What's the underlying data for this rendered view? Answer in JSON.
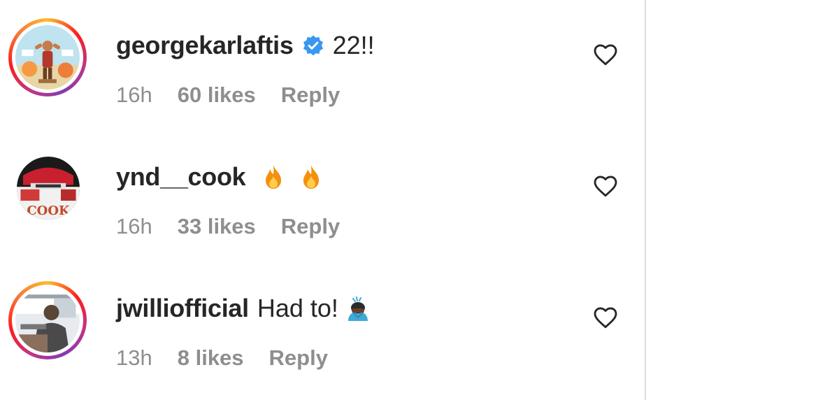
{
  "comments": [
    {
      "username": "georgekarlaftis",
      "verified": true,
      "text": "22!!",
      "time": "16h",
      "likes": "60 likes",
      "reply": "Reply",
      "avatar_ring": "story",
      "icons": {
        "verified": "verified-badge-icon",
        "like": "heart-outline-icon"
      }
    },
    {
      "username": "ynd__cook",
      "verified": false,
      "text": "",
      "emojis": [
        "fire-emoji",
        "fire-emoji"
      ],
      "avatar_text": "COOK",
      "time": "16h",
      "likes": "33 likes",
      "reply": "Reply",
      "avatar_ring": "none",
      "icons": {
        "like": "heart-outline-icon"
      }
    },
    {
      "username": "jwilliofficial",
      "verified": false,
      "text": "Had to!",
      "emojis": [
        "person-bowing-emoji"
      ],
      "time": "13h",
      "likes": "8 likes",
      "reply": "Reply",
      "avatar_ring": "story",
      "icons": {
        "like": "heart-outline-icon"
      }
    }
  ],
  "colors": {
    "username": "#262626",
    "meta": "#8e8e8e",
    "verified_blue": "#3897f0",
    "fire_orange": "#f4900c",
    "divider": "#dbdbdb"
  }
}
